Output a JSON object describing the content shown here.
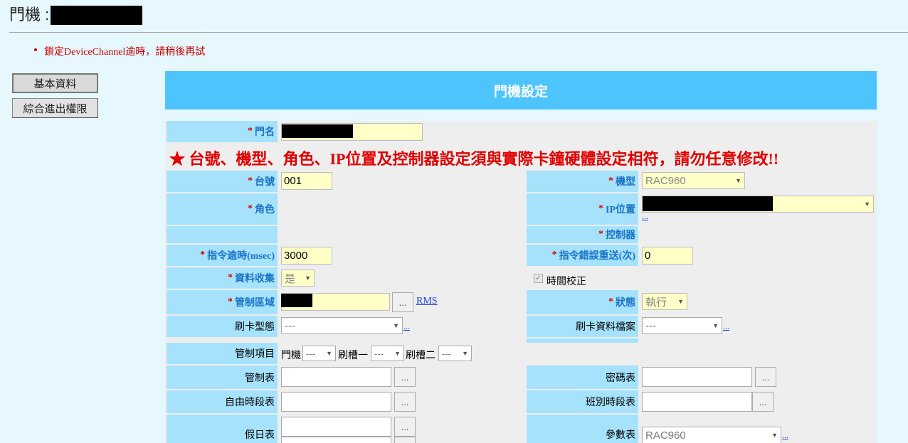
{
  "page": {
    "title": "門機 :"
  },
  "error": {
    "message": "鎖定DeviceChannel逾時，請稍後再試"
  },
  "left_nav": [
    {
      "label": "基本資料"
    },
    {
      "label": "綜合進出權限"
    }
  ],
  "header": {
    "title": "門機設定"
  },
  "form": {
    "door_name_label": "門名",
    "warning": "★ 台號、機型、角色、IP位置及控制器設定須與實際卡鐘硬體設定相符，請勿任意修改!!",
    "unit_no_label": "台號",
    "unit_no_value": "001",
    "model_label": "機型",
    "model_value": "RAC960",
    "role_label": "角色",
    "ip_label": "IP位置",
    "ip_more": "...",
    "controller_label": "控制器",
    "cmd_timeout_label": "指令逾時(msec)",
    "cmd_timeout_value": "3000",
    "cmd_retry_label": "指令錯誤重送(次)",
    "cmd_retry_value": "0",
    "data_collect_label": "資料收集",
    "data_collect_value": "是",
    "time_sync_label": "時間校正",
    "zone_label": "管制區域",
    "zone_link": "RMS",
    "status_label": "狀態",
    "status_value": "執行",
    "card_type_label": "刷卡型態",
    "card_type_value": "---",
    "card_file_label": "刷卡資料檔案",
    "card_file_value": "---",
    "control_item_label": "管制項目",
    "ci_door": "門機",
    "ci_door_value": "---",
    "ci_slot1": "刷槽一",
    "ci_slot1_value": "---",
    "ci_slot2": "刷槽二",
    "ci_slot2_value": "---",
    "control_table_label": "管制表",
    "password_table_label": "密碼表",
    "free_period_label": "自由時段表",
    "shift_period_label": "班別時段表",
    "holiday_label": "假日表",
    "param_label": "參數表",
    "param_value": "RAC960",
    "more": "...",
    "btn_dots": "..."
  }
}
